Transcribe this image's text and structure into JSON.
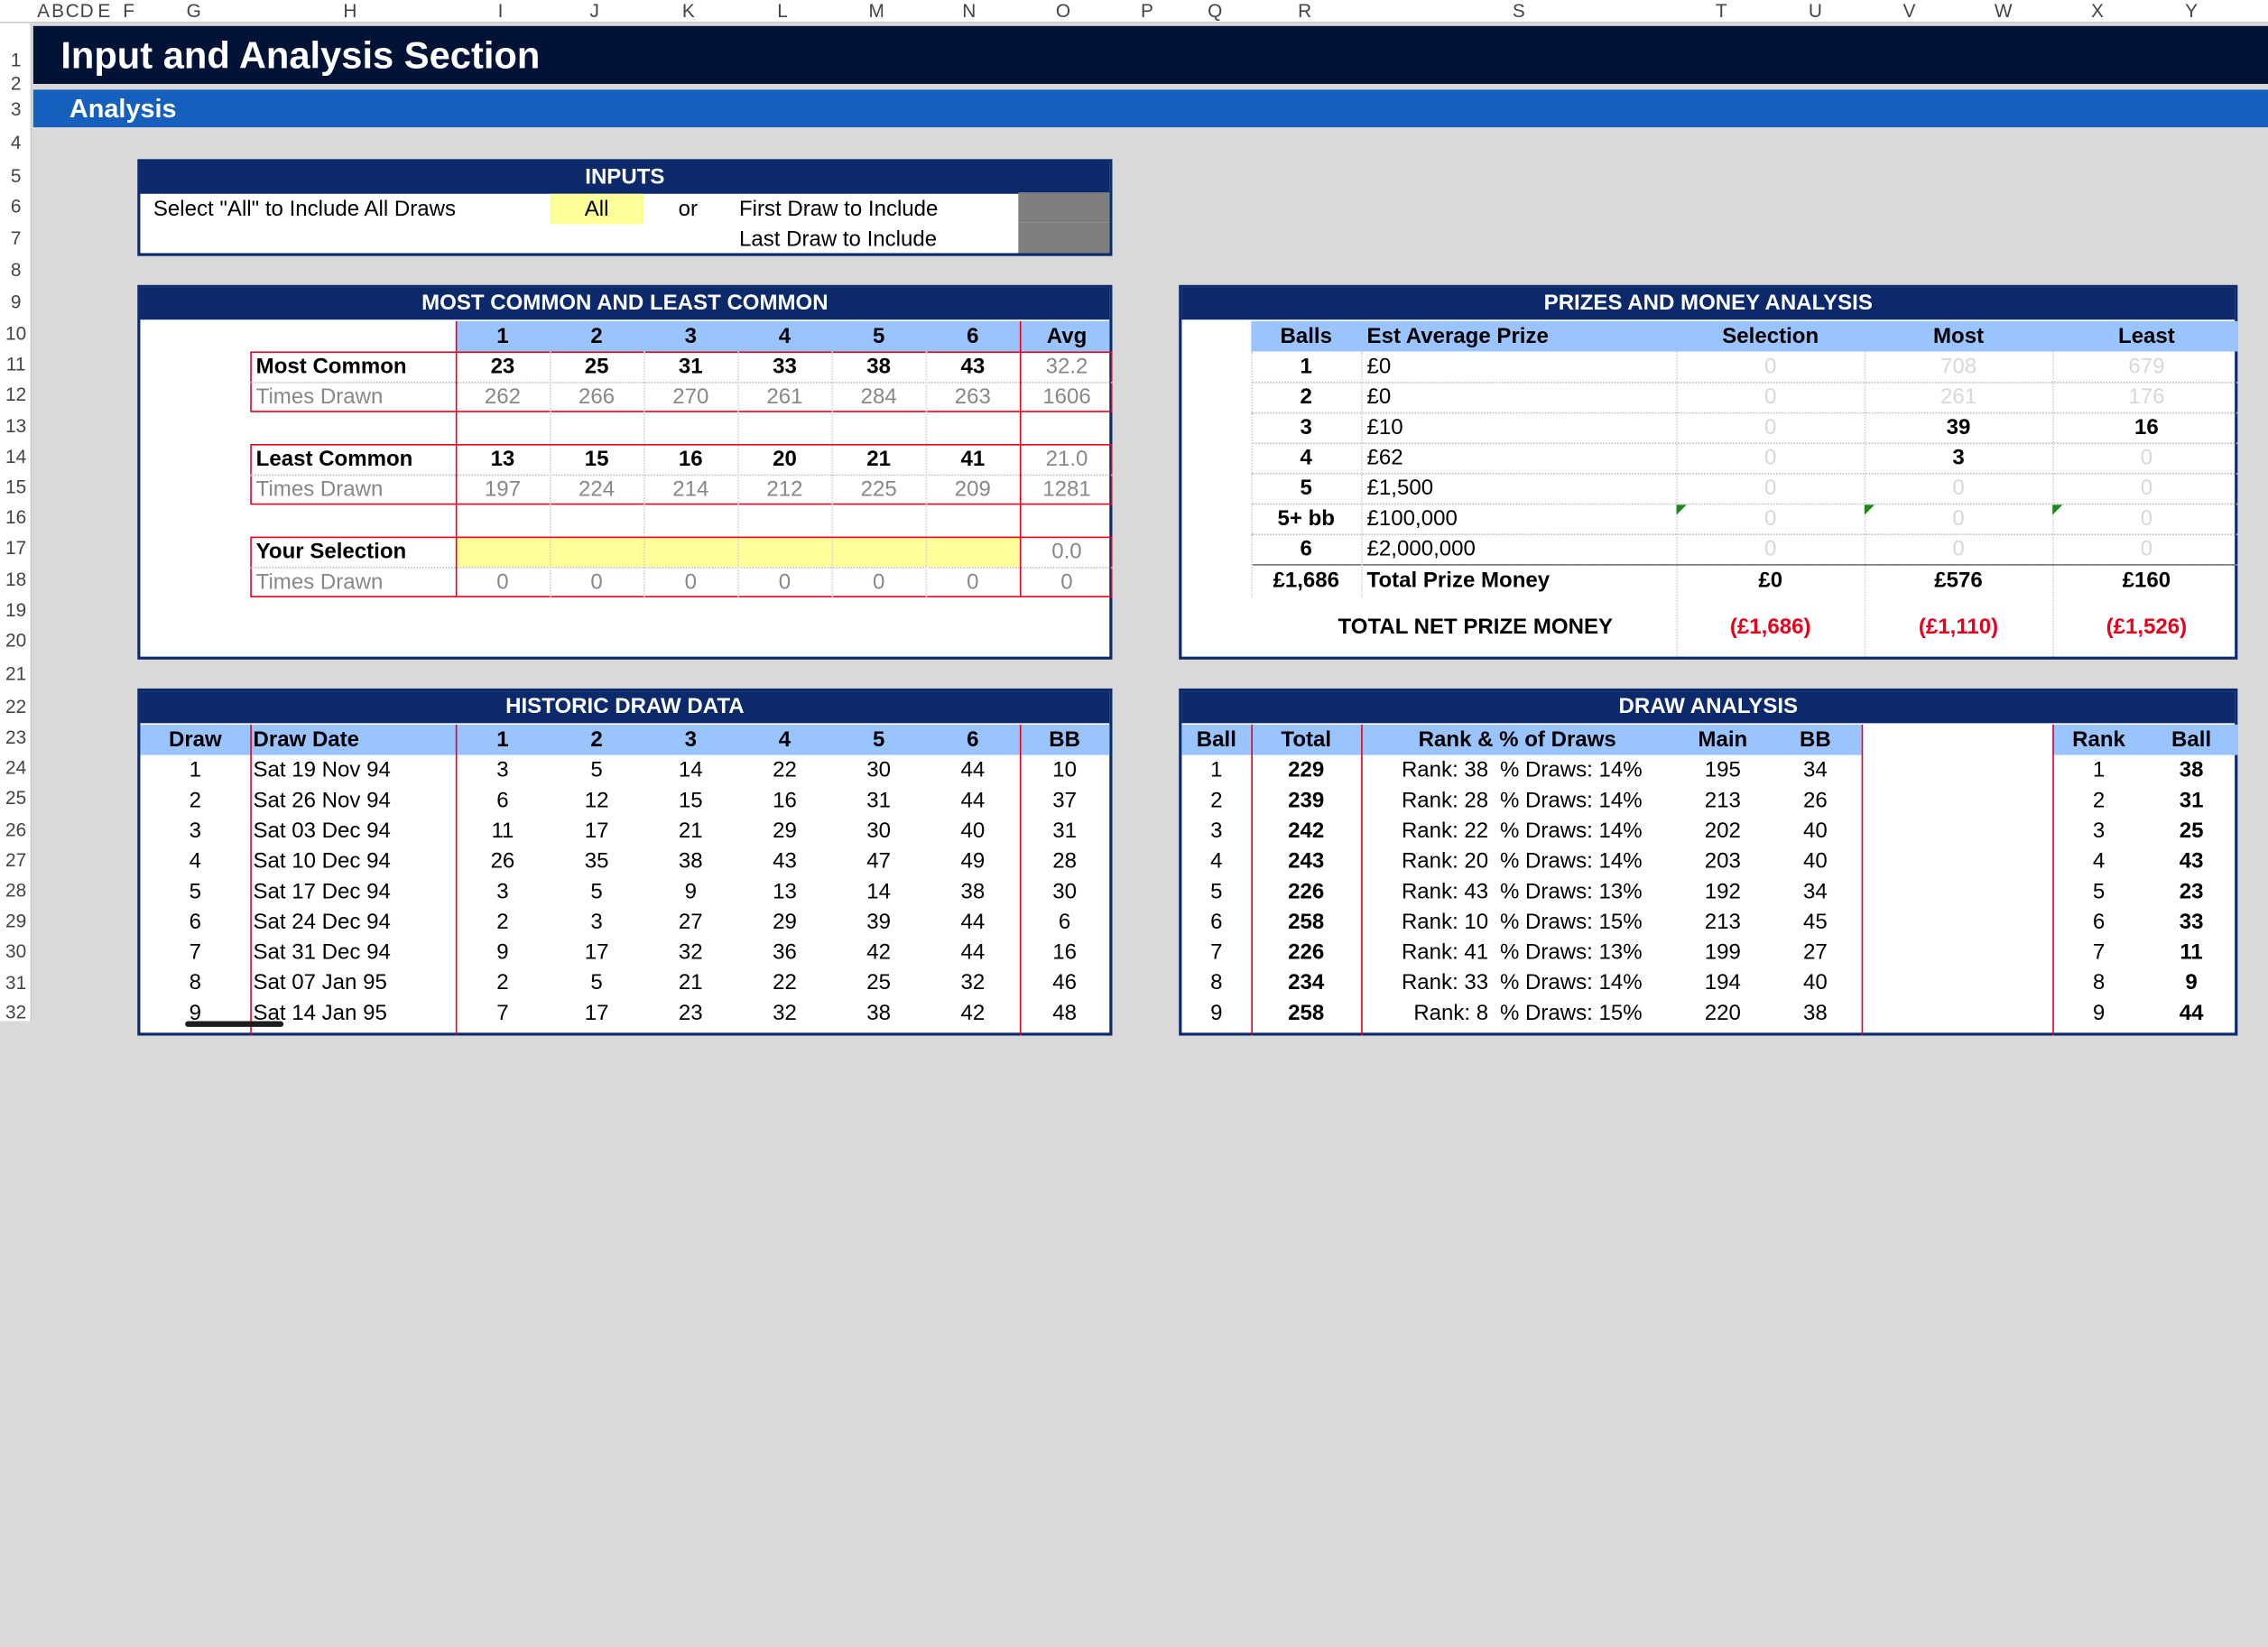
{
  "column_headers": [
    "A",
    "B",
    "C",
    "D",
    "E",
    "F",
    "G",
    "H",
    "I",
    "J",
    "K",
    "L",
    "M",
    "N",
    "O",
    "P",
    "Q",
    "R",
    "S",
    "T",
    "U",
    "V",
    "W",
    "X",
    "Y"
  ],
  "row_headers": [
    "1",
    "2",
    "3",
    "4",
    "5",
    "6",
    "7",
    "8",
    "9",
    "10",
    "11",
    "12",
    "13",
    "14",
    "15",
    "16",
    "17",
    "18",
    "19",
    "20",
    "21",
    "22",
    "23",
    "24",
    "25",
    "26",
    "27",
    "28",
    "29",
    "30",
    "31",
    "32"
  ],
  "title": "Input and Analysis Section",
  "subtitle": "Analysis",
  "inputs": {
    "heading": "INPUTS",
    "all_label": "Select \"All\" to Include All Draws",
    "all_value": "All",
    "or_label": "or",
    "first_label": "First Draw to Include",
    "last_label": "Last Draw to Include"
  },
  "mc": {
    "heading": "MOST COMMON AND LEAST COMMON",
    "cols": [
      "1",
      "2",
      "3",
      "4",
      "5",
      "6",
      "Avg"
    ],
    "rows": [
      {
        "label": "Most Common",
        "values": [
          "23",
          "25",
          "31",
          "33",
          "38",
          "43"
        ],
        "avg": "32.2",
        "kind": "bold"
      },
      {
        "label": "Times Drawn",
        "values": [
          "262",
          "266",
          "270",
          "261",
          "284",
          "263"
        ],
        "avg": "1606",
        "kind": "grey"
      },
      {
        "label": "Least Common",
        "values": [
          "13",
          "15",
          "16",
          "20",
          "21",
          "41"
        ],
        "avg": "21.0",
        "kind": "bold"
      },
      {
        "label": "Times Drawn",
        "values": [
          "197",
          "224",
          "214",
          "212",
          "225",
          "209"
        ],
        "avg": "1281",
        "kind": "grey"
      },
      {
        "label": "Your Selection",
        "values": [
          "",
          "",
          "",
          "",
          "",
          ""
        ],
        "avg": "0.0",
        "kind": "select"
      },
      {
        "label": "Times Drawn",
        "values": [
          "0",
          "0",
          "0",
          "0",
          "0",
          "0"
        ],
        "avg": "0",
        "kind": "grey0"
      }
    ]
  },
  "prizes": {
    "heading": "PRIZES AND MONEY ANALYSIS",
    "cols": [
      "Balls",
      "Est Average Prize",
      "Selection",
      "Most",
      "Least"
    ],
    "rows": [
      {
        "balls": "1",
        "prize": "£0",
        "selection": "0",
        "most": "708",
        "least": "679",
        "muted": true
      },
      {
        "balls": "2",
        "prize": "£0",
        "selection": "0",
        "most": "261",
        "least": "176",
        "muted": true
      },
      {
        "balls": "3",
        "prize": "£10",
        "selection": "0",
        "most": "39",
        "least": "16",
        "muted": false
      },
      {
        "balls": "4",
        "prize": "£62",
        "selection": "0",
        "most": "3",
        "least": "0",
        "muted": false
      },
      {
        "balls": "5",
        "prize": "£1,500",
        "selection": "0",
        "most": "0",
        "least": "0",
        "muted": false
      },
      {
        "balls": "5+ bb",
        "prize": "£100,000",
        "selection": "0",
        "most": "0",
        "least": "0",
        "muted": false
      },
      {
        "balls": "6",
        "prize": "£2,000,000",
        "selection": "0",
        "most": "0",
        "least": "0",
        "muted": false
      }
    ],
    "total": {
      "balls": "£1,686",
      "label": "Total Prize Money",
      "selection": "£0",
      "most": "£576",
      "least": "£160"
    },
    "net": {
      "label": "TOTAL NET PRIZE MONEY",
      "selection": "(£1,686)",
      "most": "(£1,110)",
      "least": "(£1,526)"
    }
  },
  "historic": {
    "heading": "HISTORIC DRAW DATA",
    "cols": [
      "Draw",
      "Draw Date",
      "1",
      "2",
      "3",
      "4",
      "5",
      "6",
      "BB"
    ],
    "rows": [
      [
        "1",
        "Sat 19 Nov 94",
        "3",
        "5",
        "14",
        "22",
        "30",
        "44",
        "10"
      ],
      [
        "2",
        "Sat 26 Nov 94",
        "6",
        "12",
        "15",
        "16",
        "31",
        "44",
        "37"
      ],
      [
        "3",
        "Sat 03 Dec 94",
        "11",
        "17",
        "21",
        "29",
        "30",
        "40",
        "31"
      ],
      [
        "4",
        "Sat 10 Dec 94",
        "26",
        "35",
        "38",
        "43",
        "47",
        "49",
        "28"
      ],
      [
        "5",
        "Sat 17 Dec 94",
        "3",
        "5",
        "9",
        "13",
        "14",
        "38",
        "30"
      ],
      [
        "6",
        "Sat 24 Dec 94",
        "2",
        "3",
        "27",
        "29",
        "39",
        "44",
        "6"
      ],
      [
        "7",
        "Sat 31 Dec 94",
        "9",
        "17",
        "32",
        "36",
        "42",
        "44",
        "16"
      ],
      [
        "8",
        "Sat 07 Jan 95",
        "2",
        "5",
        "21",
        "22",
        "25",
        "32",
        "46"
      ],
      [
        "9",
        "Sat 14 Jan 95",
        "7",
        "17",
        "23",
        "32",
        "38",
        "42",
        "48"
      ]
    ]
  },
  "draw": {
    "heading": "DRAW ANALYSIS",
    "cols": [
      "Ball",
      "Total",
      "Rank & % of Draws",
      "Main",
      "BB",
      "Rank",
      "Ball"
    ],
    "rows": [
      {
        "ball": "1",
        "total": "229",
        "rank_txt": "Rank: 38",
        "pct": "% Draws: 14%",
        "main": "195",
        "bb": "34",
        "rank": "1",
        "rball": "38"
      },
      {
        "ball": "2",
        "total": "239",
        "rank_txt": "Rank: 28",
        "pct": "% Draws: 14%",
        "main": "213",
        "bb": "26",
        "rank": "2",
        "rball": "31"
      },
      {
        "ball": "3",
        "total": "242",
        "rank_txt": "Rank: 22",
        "pct": "% Draws: 14%",
        "main": "202",
        "bb": "40",
        "rank": "3",
        "rball": "25"
      },
      {
        "ball": "4",
        "total": "243",
        "rank_txt": "Rank: 20",
        "pct": "% Draws: 14%",
        "main": "203",
        "bb": "40",
        "rank": "4",
        "rball": "43"
      },
      {
        "ball": "5",
        "total": "226",
        "rank_txt": "Rank: 43",
        "pct": "% Draws: 13%",
        "main": "192",
        "bb": "34",
        "rank": "5",
        "rball": "23"
      },
      {
        "ball": "6",
        "total": "258",
        "rank_txt": "Rank: 10",
        "pct": "% Draws: 15%",
        "main": "213",
        "bb": "45",
        "rank": "6",
        "rball": "33"
      },
      {
        "ball": "7",
        "total": "226",
        "rank_txt": "Rank: 41",
        "pct": "% Draws: 13%",
        "main": "199",
        "bb": "27",
        "rank": "7",
        "rball": "11"
      },
      {
        "ball": "8",
        "total": "234",
        "rank_txt": "Rank: 33",
        "pct": "% Draws: 14%",
        "main": "194",
        "bb": "40",
        "rank": "8",
        "rball": "9"
      },
      {
        "ball": "9",
        "total": "258",
        "rank_txt": "Rank: 8",
        "pct": "% Draws: 15%",
        "main": "220",
        "bb": "38",
        "rank": "9",
        "rball": "44"
      }
    ]
  }
}
